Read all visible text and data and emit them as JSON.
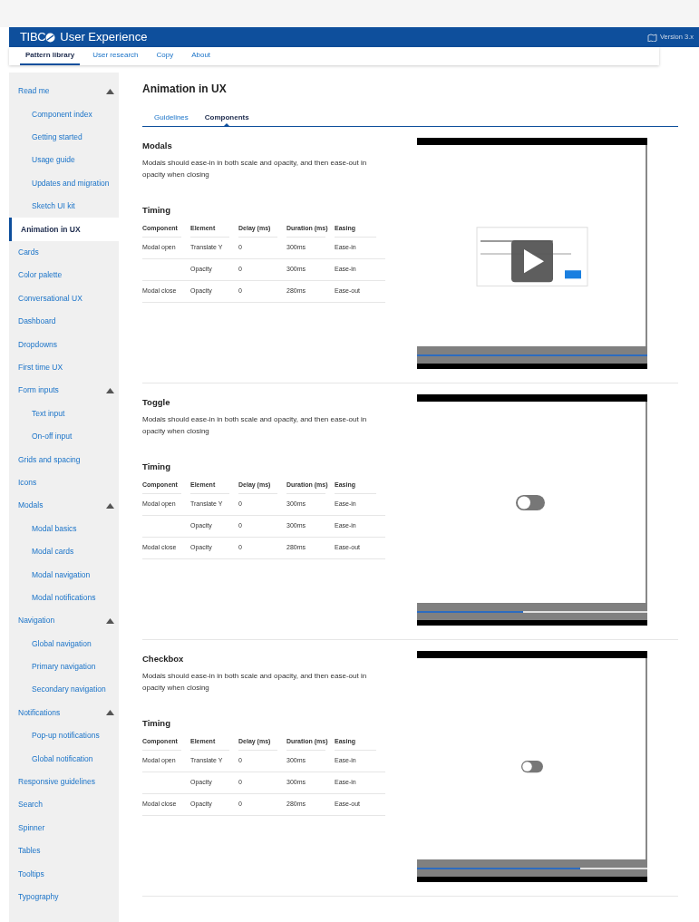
{
  "header": {
    "brand": "TIBC",
    "title": "User Experience",
    "version": "Version 3.x"
  },
  "nav": [
    {
      "label": "Pattern library",
      "selected": true
    },
    {
      "label": "User research",
      "selected": false
    },
    {
      "label": "Copy",
      "selected": false
    },
    {
      "label": "About",
      "selected": false
    }
  ],
  "sidebar": {
    "items": [
      {
        "label": "Read me",
        "selected": false,
        "expanded": true,
        "children": [
          {
            "label": "Component index",
            "selected": false
          },
          {
            "label": "Getting started",
            "selected": false
          },
          {
            "label": "Usage guide",
            "selected": false
          },
          {
            "label": "Updates and migration",
            "selected": false
          },
          {
            "label": "Sketch UI kit",
            "selected": false
          }
        ]
      },
      {
        "label": "Animation in UX",
        "selected": true
      },
      {
        "label": "Cards",
        "selected": false
      },
      {
        "label": "Color palette",
        "selected": false
      },
      {
        "label": "Conversational UX",
        "selected": false
      },
      {
        "label": "Dashboard",
        "selected": false
      },
      {
        "label": "Dropdowns",
        "selected": false
      },
      {
        "label": "First time UX",
        "selected": false
      },
      {
        "label": "Form inputs",
        "selected": false,
        "expanded": true,
        "children": [
          {
            "label": "Text input",
            "selected": false
          },
          {
            "label": "On-off input",
            "selected": false
          }
        ]
      },
      {
        "label": "Grids and spacing",
        "selected": false
      },
      {
        "label": "Icons",
        "selected": false
      },
      {
        "label": "Modals",
        "selected": false,
        "expanded": true,
        "children": [
          {
            "label": "Modal basics",
            "selected": false
          },
          {
            "label": "Modal cards",
            "selected": false
          },
          {
            "label": "Modal navigation",
            "selected": false
          },
          {
            "label": "Modal notifications",
            "selected": false
          }
        ]
      },
      {
        "label": "Navigation",
        "selected": false,
        "expanded": true,
        "children": [
          {
            "label": "Global navigation",
            "selected": false
          },
          {
            "label": "Primary navigation",
            "selected": false
          },
          {
            "label": "Secondary navigation",
            "selected": false
          }
        ]
      },
      {
        "label": "Notifications",
        "selected": false,
        "expanded": true,
        "children": [
          {
            "label": "Pop-up notifications",
            "selected": false
          },
          {
            "label": "Global notification",
            "selected": false
          }
        ]
      },
      {
        "label": "Responsive guidelines",
        "selected": false
      },
      {
        "label": "Search",
        "selected": false
      },
      {
        "label": "Spinner",
        "selected": false
      },
      {
        "label": "Tables",
        "selected": false
      },
      {
        "label": "Tooltips",
        "selected": false
      },
      {
        "label": "Typography",
        "selected": false
      }
    ]
  },
  "page": {
    "title": "Animation in UX",
    "tabs": [
      {
        "label": "Guidelines",
        "selected": false
      },
      {
        "label": "Components",
        "selected": true
      }
    ]
  },
  "sections": [
    {
      "title": "Modals",
      "description": "Modals should ease-in in both scale and opacity, and then ease-out in opacity when closing",
      "timing_title": "Timing",
      "columns": [
        "Component",
        "Element",
        "Delay (ms)",
        "Duration (ms)",
        "Easing"
      ],
      "rows": [
        [
          "Modal open",
          "Translate Y",
          "0",
          "300ms",
          "Ease-in"
        ],
        [
          "",
          "Opacity",
          "0",
          "300ms",
          "Ease-in"
        ],
        [
          "Modal close",
          "Opacity",
          "0",
          "280ms",
          "Ease-out"
        ]
      ],
      "video": {
        "kind": "modal",
        "level": 1.0
      }
    },
    {
      "title": "Toggle",
      "description": "Modals should ease-in in both scale and opacity, and then ease-out in opacity when closing",
      "timing_title": "Timing",
      "columns": [
        "Component",
        "Element",
        "Delay (ms)",
        "Duration (ms)",
        "Easing"
      ],
      "rows": [
        [
          "Modal open",
          "Translate Y",
          "0",
          "300ms",
          "Ease-in"
        ],
        [
          "",
          "Opacity",
          "0",
          "300ms",
          "Ease-in"
        ],
        [
          "Modal close",
          "Opacity",
          "0",
          "280ms",
          "Ease-out"
        ]
      ],
      "video": {
        "kind": "toggle",
        "level": 0.46
      }
    },
    {
      "title": "Checkbox",
      "description": "Modals should ease-in in both scale and opacity, and then ease-out in opacity when closing",
      "timing_title": "Timing",
      "columns": [
        "Component",
        "Element",
        "Delay (ms)",
        "Duration (ms)",
        "Easing"
      ],
      "rows": [
        [
          "Modal open",
          "Translate Y",
          "0",
          "300ms",
          "Ease-in"
        ],
        [
          "",
          "Opacity",
          "0",
          "300ms",
          "Ease-in"
        ],
        [
          "Modal close",
          "Opacity",
          "0",
          "280ms",
          "Ease-out"
        ]
      ],
      "video": {
        "kind": "toggle-small",
        "level": 0.71
      }
    }
  ]
}
